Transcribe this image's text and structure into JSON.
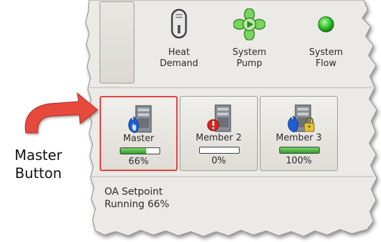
{
  "top_status": {
    "heat_demand": {
      "label": "Heat\nDemand",
      "icon": "switch-icon"
    },
    "system_pump": {
      "label": "System\nPump",
      "icon": "pump-icon"
    },
    "system_flow": {
      "label": "System\nFlow",
      "icon": "status-light-icon"
    }
  },
  "boilers": [
    {
      "name": "Master",
      "percent_label": "66%",
      "progress": 0.66,
      "icon": "boiler-flame-icon",
      "selected": true
    },
    {
      "name": "Member 2",
      "percent_label": "0%",
      "progress": 0.0,
      "icon": "boiler-alert-icon",
      "selected": false
    },
    {
      "name": "Member 3",
      "percent_label": "100%",
      "progress": 1.0,
      "icon": "boiler-lock-icon",
      "selected": false
    }
  ],
  "info": {
    "line1": "OA Setpoint",
    "line2": "Running 66%"
  },
  "callout": {
    "label": "Master\nButton"
  },
  "colors": {
    "highlight": "#e0413f",
    "progress": "#2ea02b",
    "status_light": "#2fc32c",
    "pump": "#7bd45c"
  }
}
